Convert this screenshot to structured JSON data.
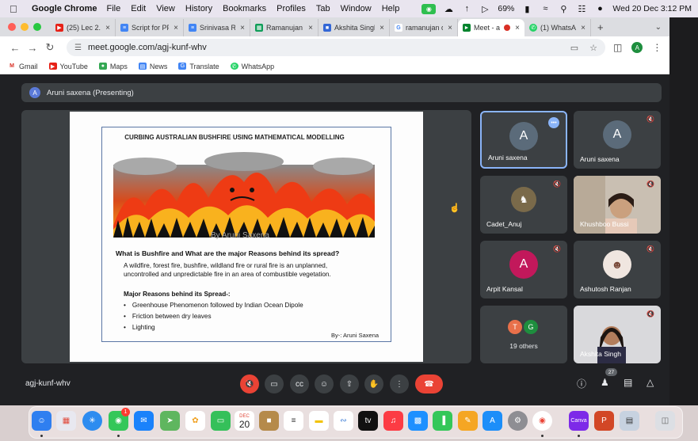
{
  "menubar": {
    "app": "Google Chrome",
    "items": [
      "File",
      "Edit",
      "View",
      "History",
      "Bookmarks",
      "Profiles",
      "Tab",
      "Window",
      "Help"
    ],
    "battery": "69%",
    "clock": "Wed 20 Dec  3:12 PM"
  },
  "tabs": [
    {
      "label": "(25) Lec 2.1",
      "color": "#e62117"
    },
    {
      "label": "Script for PP",
      "color": "#4285f4"
    },
    {
      "label": "Srinivasa Ra",
      "color": "#4285f4"
    },
    {
      "label": "Ramanujan",
      "color": "#0f9d58"
    },
    {
      "label": "Akshita Singh",
      "color": "#4285f4"
    },
    {
      "label": "ramanujan d",
      "color": "#888888"
    },
    {
      "label": "Meet - a",
      "color": "#00832d"
    },
    {
      "label": "(1) WhatsApp",
      "color": "#25d366"
    }
  ],
  "address": {
    "url": "meet.google.com/agj-kunf-whv"
  },
  "profile_initial": "A",
  "bookmarks": [
    "Gmail",
    "YouTube",
    "Maps",
    "News",
    "Translate",
    "WhatsApp"
  ],
  "meet": {
    "presenting_initial": "A",
    "presenting_label": "Aruni saxena (Presenting)",
    "meeting_code": "agj-kunf-whv",
    "participants_count": "27",
    "others_count_label": "19 others"
  },
  "slide": {
    "title": "CURBING AUSTRALIAN BUSHFIRE USING MATHEMATICAL MODELLING",
    "watermark": "By Aruni Saxena",
    "heading": "What is Bushfire and What are the major Reasons behind its spread?",
    "paragraph": "A wildfire, forest fire, bushfire, wildland fire or rural fire is an unplanned, uncontrolled and unpredictable fire in an area of combustible vegetation.",
    "reasons_heading": "Major Reasons behind its Spread-:",
    "reasons": [
      "Greenhouse Phenomenon followed by Indian Ocean Dipole",
      "Friction between dry leaves",
      "Lighting"
    ],
    "byline": "By-: Aruni Saxena"
  },
  "tiles": [
    {
      "name": "Aruni saxena",
      "initial": "A",
      "color": "#5b6b7a"
    },
    {
      "name": "Aruni saxena",
      "initial": "A",
      "color": "#5b6b7a"
    },
    {
      "name": "Cadet_Anuj"
    },
    {
      "name": "Khushboo Bussi"
    },
    {
      "name": "Arpit Kansal",
      "initial": "A",
      "color": "#c2185b"
    },
    {
      "name": "Ashutosh Ranjan"
    },
    {
      "mini_initials": [
        "T",
        "G"
      ]
    },
    {
      "name": "Akshita Singh"
    }
  ],
  "dock": {
    "calendar_day": "20",
    "calendar_month": "DEC",
    "messages_badge": "1"
  }
}
